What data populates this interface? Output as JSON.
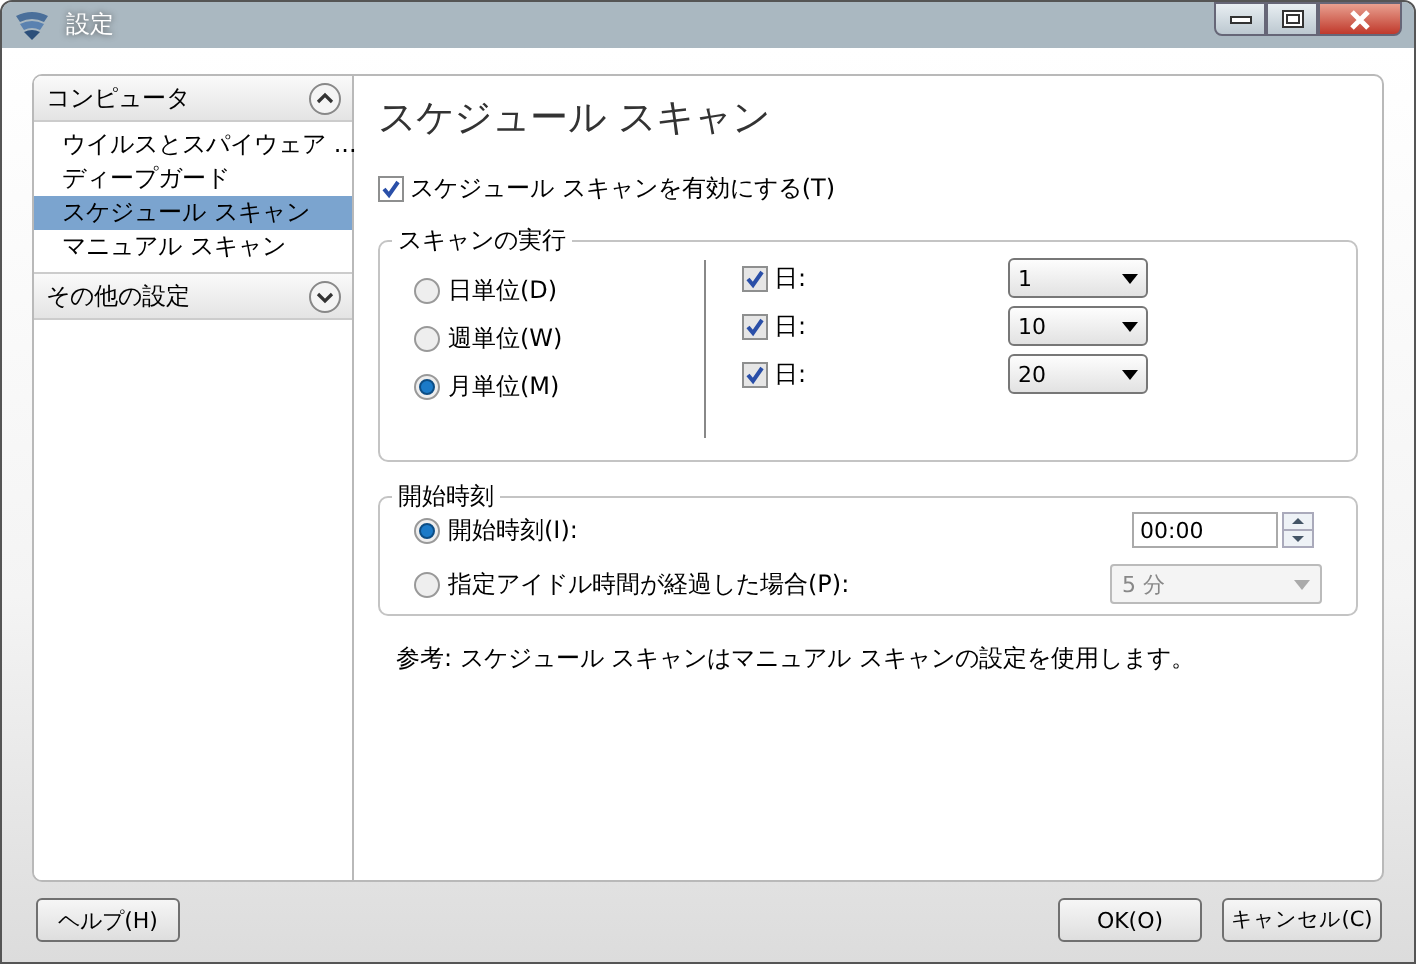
{
  "window": {
    "title": "設定"
  },
  "sidebar": {
    "sections": [
      {
        "label": "コンピュータ",
        "expanded": true,
        "items": [
          {
            "label": "ウイルスとスパイウェア ...",
            "selected": false
          },
          {
            "label": "ディープガード",
            "selected": false
          },
          {
            "label": "スケジュール スキャン",
            "selected": true
          },
          {
            "label": "マニュアル スキャン",
            "selected": false
          }
        ]
      },
      {
        "label": "その他の設定",
        "expanded": false
      }
    ]
  },
  "page": {
    "title": "スケジュール スキャン",
    "enable": {
      "label": "スケジュール スキャンを有効にする(T)",
      "checked": true
    },
    "run_group": {
      "title": "スキャンの実行",
      "frequencies": [
        {
          "label": "日単位(D)",
          "selected": false
        },
        {
          "label": "週単位(W)",
          "selected": false
        },
        {
          "label": "月単位(M)",
          "selected": true
        }
      ],
      "days": [
        {
          "label": "日:",
          "checked": true,
          "value": "1"
        },
        {
          "label": "日:",
          "checked": true,
          "value": "10"
        },
        {
          "label": "日:",
          "checked": true,
          "value": "20"
        }
      ]
    },
    "start_group": {
      "title": "開始時刻",
      "options": [
        {
          "kind": "time",
          "label": "開始時刻(I):",
          "selected": true,
          "value": "00:00"
        },
        {
          "kind": "dropdown",
          "label": "指定アイドル時間が経過した場合(P):",
          "selected": false,
          "value": "5 分",
          "disabled": true
        }
      ]
    },
    "note": "参考: スケジュール スキャンはマニュアル スキャンの設定を使用します。"
  },
  "footer": {
    "left": [
      {
        "label": "ヘルプ(H)"
      }
    ],
    "right": [
      {
        "label": "OK(O)"
      },
      {
        "label": "キャンセル(C)"
      }
    ]
  }
}
